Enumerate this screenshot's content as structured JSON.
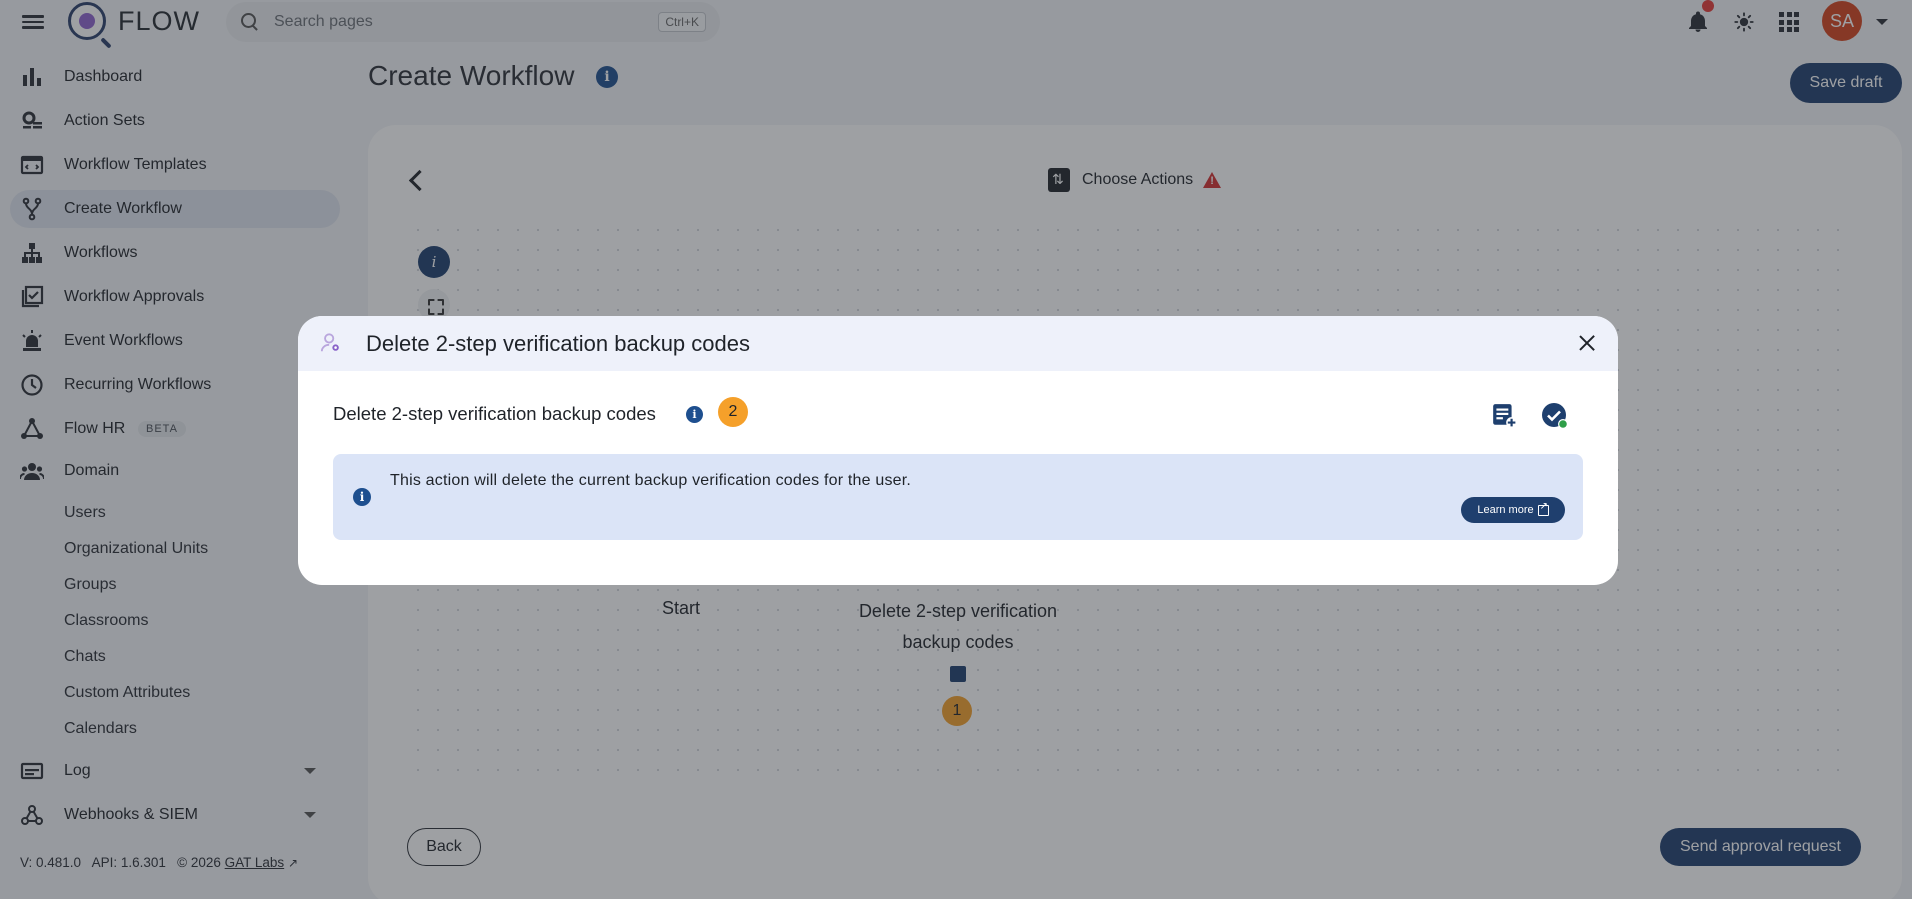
{
  "app": {
    "name": "FLOW"
  },
  "search": {
    "placeholder": "Search pages",
    "shortcut": "Ctrl+K"
  },
  "user": {
    "initials": "SA"
  },
  "sidebar": {
    "items": [
      {
        "label": "Dashboard",
        "icon": "bar-chart-icon"
      },
      {
        "label": "Action Sets",
        "icon": "gear-list-icon"
      },
      {
        "label": "Workflow Templates",
        "icon": "template-icon"
      },
      {
        "label": "Create Workflow",
        "icon": "fork-icon"
      },
      {
        "label": "Workflows",
        "icon": "hierarchy-icon"
      },
      {
        "label": "Workflow Approvals",
        "icon": "checked-box-icon"
      },
      {
        "label": "Event Workflows",
        "icon": "alarm-light-icon"
      },
      {
        "label": "Recurring Workflows",
        "icon": "clock-icon"
      },
      {
        "label": "Flow HR",
        "icon": "network-icon",
        "badge": "BETA"
      },
      {
        "label": "Domain",
        "icon": "people-icon"
      }
    ],
    "domain_subitems": [
      "Users",
      "Organizational Units",
      "Groups",
      "Classrooms",
      "Chats",
      "Custom Attributes",
      "Calendars"
    ],
    "log": "Log",
    "webhooks": "Webhooks & SIEM",
    "version": "V: 0.481.0",
    "api": "API: 1.6.301",
    "copyright": "© 2026",
    "company": "GAT Labs"
  },
  "main": {
    "title": "Create Workflow",
    "save_draft": "Save draft",
    "step_title": "Choose Actions",
    "start_node": "Start",
    "action_node": "Delete 2-step verification backup codes",
    "action_badge": "1",
    "back": "Back",
    "send_approval": "Send approval request"
  },
  "modal": {
    "title": "Delete 2-step verification backup codes",
    "action_title": "Delete 2-step verification backup codes",
    "badge": "2",
    "info_text": "This action will delete the current backup verification codes for the user.",
    "learn_more": "Learn more"
  },
  "colors": {
    "primary": "#1f3f6e",
    "accent_badge": "#f5a02a",
    "avatar": "#d4431d",
    "warning": "#d32f2f",
    "info_box": "#dbe4f7"
  }
}
